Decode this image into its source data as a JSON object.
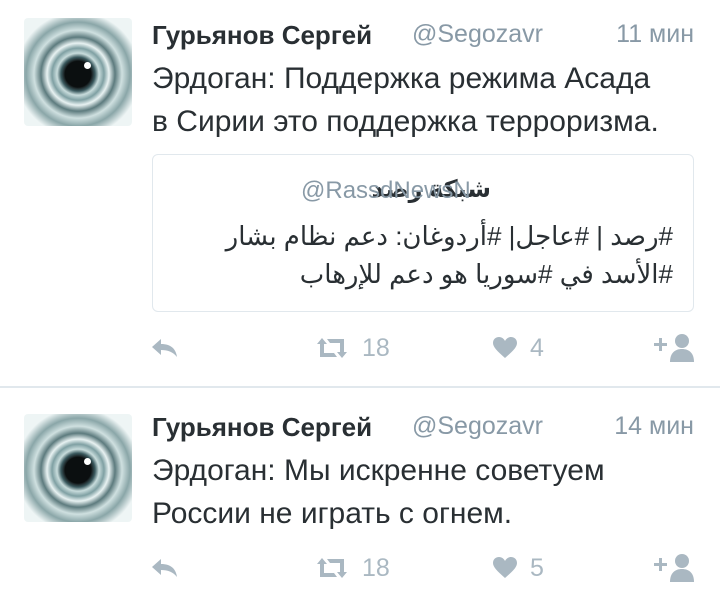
{
  "colors": {
    "text": "#292f33",
    "secondary": "#8899a6",
    "icon": "#aab8c2",
    "border": "#e1e8ed"
  },
  "tweets": [
    {
      "name": "Гурьянов Сергей",
      "handle": "@Segozavr",
      "time": "11 мин",
      "text_lines": [
        "Эрдоган: Поддержка режима Асада",
        "в Сирии это поддержка терроризма."
      ],
      "quote": {
        "name": "شبكة رصد",
        "handle": "@RassdNewsN",
        "text_lines": [
          "#رصد | #عاجل| #أردوغان: دعم نظام بشار",
          "#الأسد في #سوريا هو دعم للإرهاب"
        ]
      },
      "actions": {
        "reply_icon": "reply-icon",
        "retweet_icon": "retweet-icon",
        "retweets": "18",
        "like_icon": "heart-icon",
        "likes": "4",
        "follow_icon": "add-user-icon"
      }
    },
    {
      "name": "Гурьянов Сергей",
      "handle": "@Segozavr",
      "time": "14 мин",
      "text_lines": [
        "Эрдоган: Мы искренне советуем",
        "России не играть с огнем."
      ],
      "actions": {
        "reply_icon": "reply-icon",
        "retweet_icon": "retweet-icon",
        "retweets": "18",
        "like_icon": "heart-icon",
        "likes": "5",
        "follow_icon": "add-user-icon"
      }
    }
  ]
}
